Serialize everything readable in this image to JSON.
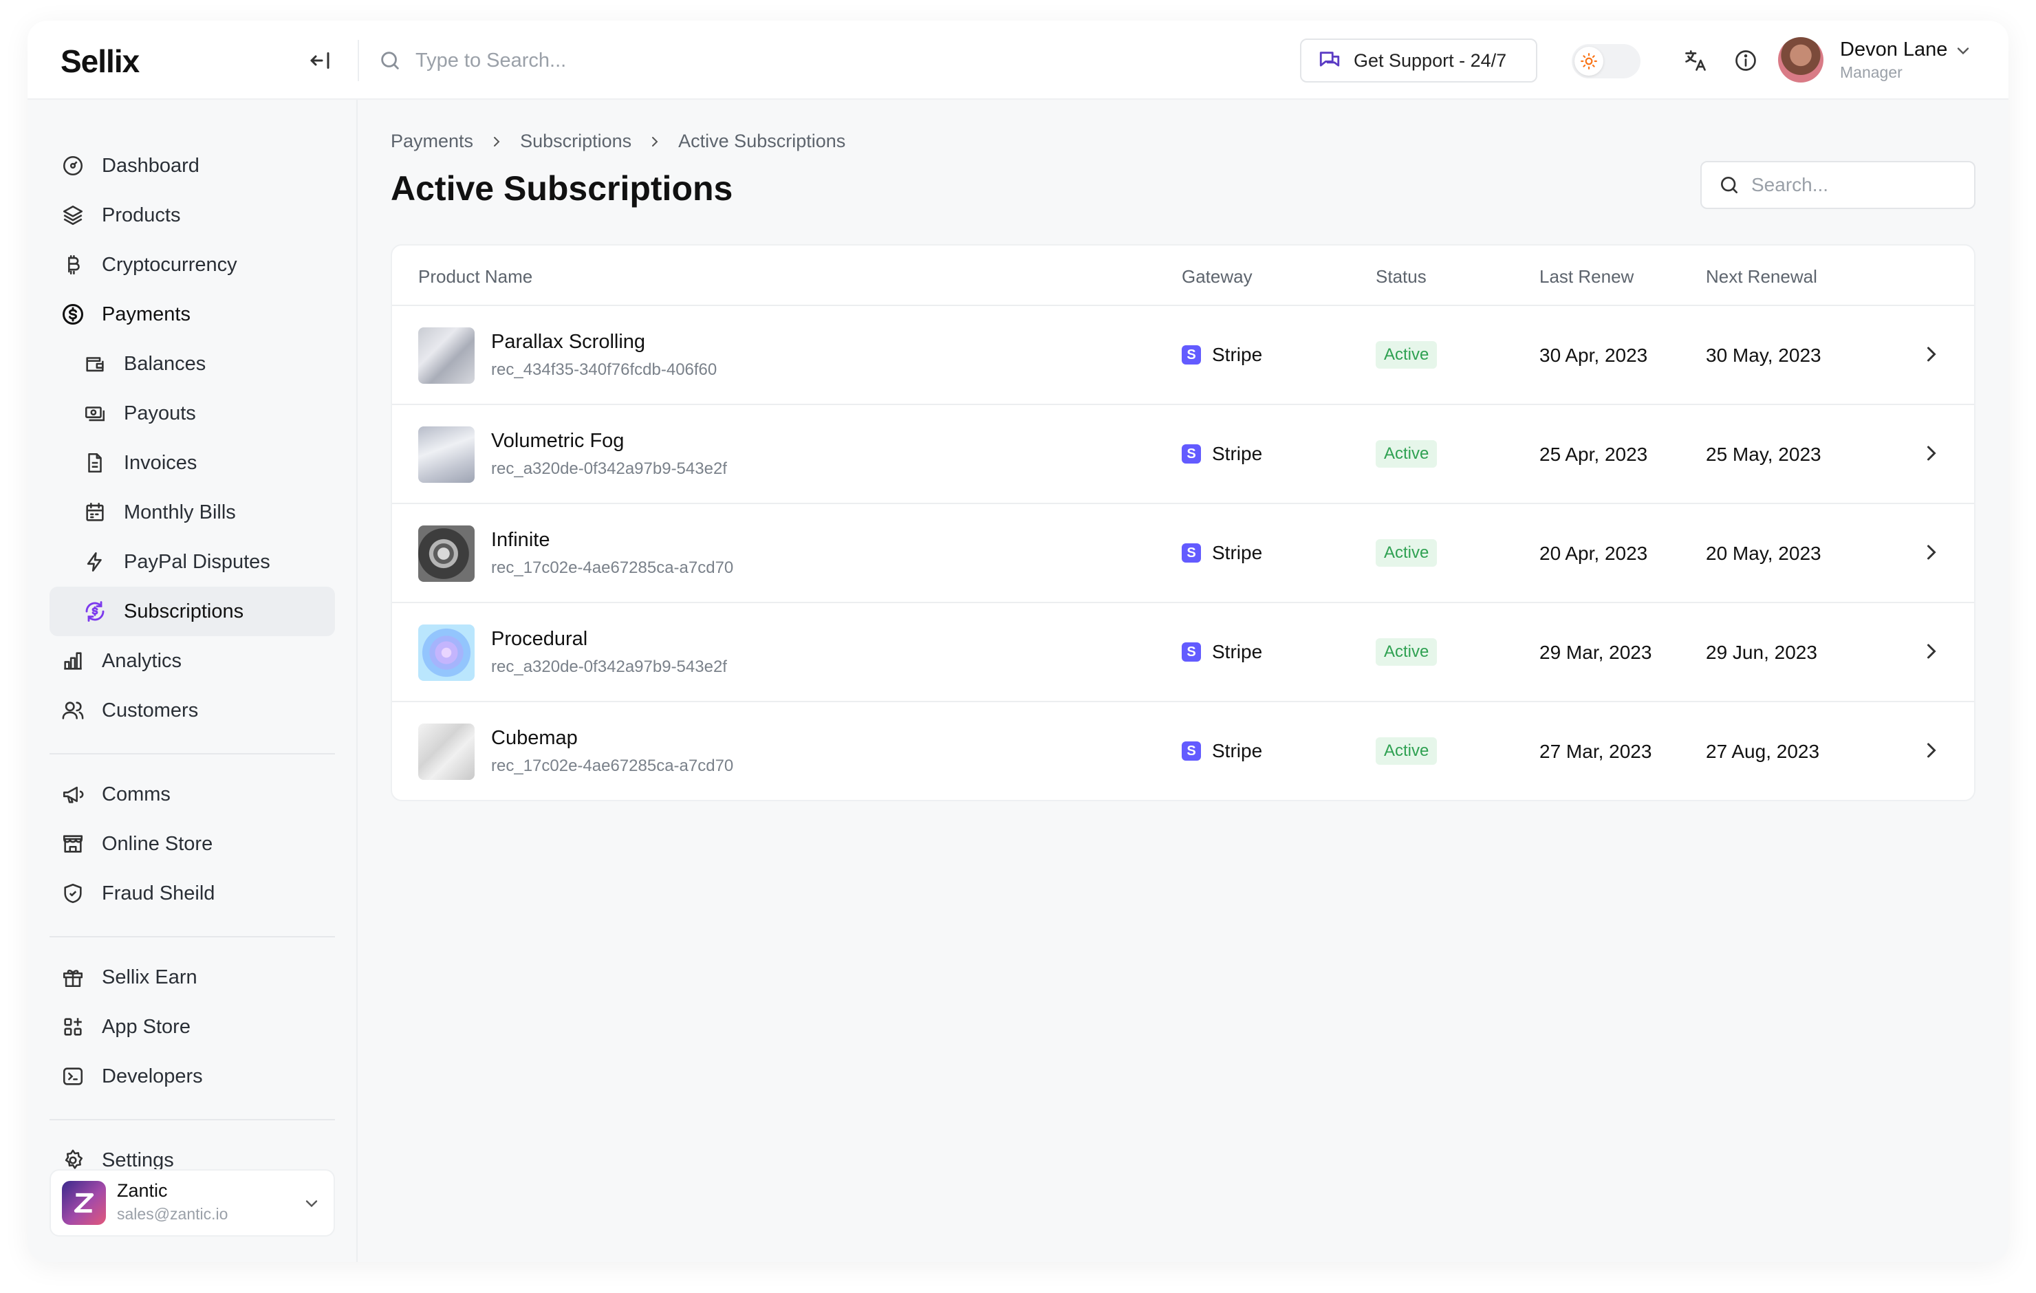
{
  "app": {
    "logo": "Sellix"
  },
  "topbar": {
    "search_placeholder": "Type to Search...",
    "support_label": "Get Support - 24/7",
    "user_name": "Devon Lane",
    "user_role": "Manager"
  },
  "sidebar": {
    "items": [
      {
        "label": "Dashboard",
        "icon": "dashboard-icon"
      },
      {
        "label": "Products",
        "icon": "layers-icon"
      },
      {
        "label": "Cryptocurrency",
        "icon": "bitcoin-icon"
      },
      {
        "label": "Payments",
        "icon": "dollar-circle-icon"
      },
      {
        "label": "Balances",
        "icon": "wallet-icon"
      },
      {
        "label": "Payouts",
        "icon": "payout-icon"
      },
      {
        "label": "Invoices",
        "icon": "invoice-icon"
      },
      {
        "label": "Monthly Bills",
        "icon": "calendar-icon"
      },
      {
        "label": "PayPal Disputes",
        "icon": "bolt-icon"
      },
      {
        "label": "Subscriptions",
        "icon": "subscription-icon"
      },
      {
        "label": "Analytics",
        "icon": "chart-icon"
      },
      {
        "label": "Customers",
        "icon": "users-icon"
      },
      {
        "label": "Comms",
        "icon": "megaphone-icon"
      },
      {
        "label": "Online Store",
        "icon": "store-icon"
      },
      {
        "label": "Fraud Sheild",
        "icon": "shield-icon"
      },
      {
        "label": "Sellix Earn",
        "icon": "gift-icon"
      },
      {
        "label": "App Store",
        "icon": "apps-icon"
      },
      {
        "label": "Developers",
        "icon": "terminal-icon"
      },
      {
        "label": "Settings",
        "icon": "gear-icon"
      }
    ],
    "account": {
      "name": "Zantic",
      "email": "sales@zantic.io"
    }
  },
  "main": {
    "breadcrumb": [
      "Payments",
      "Subscriptions",
      "Active Subscriptions"
    ],
    "title": "Active Subscriptions",
    "search_placeholder": "Search...",
    "columns": [
      "Product Name",
      "Gateway",
      "Status",
      "Last Renew",
      "Next Renewal"
    ],
    "rows": [
      {
        "name": "Parallax Scrolling",
        "id": "rec_434f35-340f76fcdb-406f60",
        "gateway": "Stripe",
        "status": "Active",
        "last": "30 Apr, 2023",
        "next": "30 May, 2023"
      },
      {
        "name": "Volumetric Fog",
        "id": "rec_a320de-0f342a97b9-543e2f",
        "gateway": "Stripe",
        "status": "Active",
        "last": "25 Apr, 2023",
        "next": "25 May, 2023"
      },
      {
        "name": "Infinite",
        "id": "rec_17c02e-4ae67285ca-a7cd70",
        "gateway": "Stripe",
        "status": "Active",
        "last": "20 Apr, 2023",
        "next": "20 May, 2023"
      },
      {
        "name": "Procedural",
        "id": "rec_a320de-0f342a97b9-543e2f",
        "gateway": "Stripe",
        "status": "Active",
        "last": "29 Mar, 2023",
        "next": "29 Jun, 2023"
      },
      {
        "name": "Cubemap",
        "id": "rec_17c02e-4ae67285ca-a7cd70",
        "gateway": "Stripe",
        "status": "Active",
        "last": "27 Mar, 2023",
        "next": "27 Aug, 2023"
      }
    ]
  },
  "colors": {
    "accent": "#635bff",
    "active_badge_bg": "#e6f6ea",
    "active_badge_text": "#2fa152",
    "subscriptions_icon": "#7c3aed"
  }
}
